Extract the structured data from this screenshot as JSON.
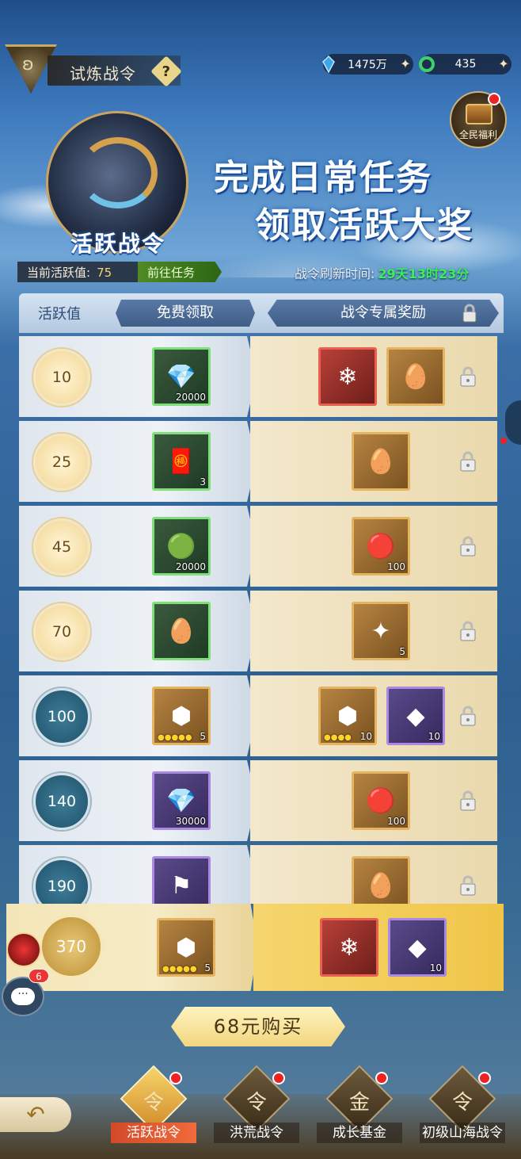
{
  "header": {
    "title": "试炼战令",
    "help_label": "?",
    "currency": [
      {
        "name": "jade-icon",
        "value": "1475万"
      },
      {
        "name": "ring-icon",
        "value": "435"
      }
    ],
    "welfare_label": "全民福利"
  },
  "banner": {
    "emblem_label": "活跃战令",
    "headline_1": "完成日常任务",
    "headline_2": "领取活跃大奖"
  },
  "activity": {
    "current_label": "当前活跃值:",
    "current_value": "75",
    "goto_label": "前往任务",
    "refresh_label": "战令刷新时间:",
    "refresh_value": "29天13时23分"
  },
  "table": {
    "col_activity": "活跃值",
    "col_free": "免费领取",
    "col_pass": "战令专属奖励",
    "rows": [
      {
        "value": "10",
        "style": "gold",
        "free": {
          "quality": "green",
          "icon": "💎",
          "count": "20000"
        },
        "pass": [
          {
            "quality": "red",
            "icon": "❄",
            "count": ""
          },
          {
            "quality": "gold",
            "icon": "🥚",
            "count": ""
          }
        ]
      },
      {
        "value": "25",
        "style": "gold",
        "free": {
          "quality": "green",
          "icon": "🧧",
          "count": "3"
        },
        "pass": [
          {
            "quality": "gold",
            "icon": "🥚",
            "count": ""
          }
        ]
      },
      {
        "value": "45",
        "style": "gold",
        "free": {
          "quality": "green",
          "icon": "🟢",
          "count": "20000"
        },
        "pass": [
          {
            "quality": "gold",
            "icon": "🔴",
            "count": "100"
          }
        ]
      },
      {
        "value": "70",
        "style": "gold",
        "free": {
          "quality": "green",
          "icon": "🥚",
          "count": ""
        },
        "pass": [
          {
            "quality": "gold",
            "icon": "✦",
            "count": "5"
          }
        ]
      },
      {
        "value": "100",
        "style": "blue",
        "free": {
          "quality": "gold",
          "icon": "⬢",
          "count": "5",
          "stars": "●●●●●"
        },
        "pass": [
          {
            "quality": "gold",
            "icon": "⬢",
            "count": "10",
            "stars": "●●●●"
          },
          {
            "quality": "purple",
            "icon": "◆",
            "count": "10"
          }
        ]
      },
      {
        "value": "140",
        "style": "blue",
        "free": {
          "quality": "purple",
          "icon": "💎",
          "count": "30000"
        },
        "pass": [
          {
            "quality": "gold",
            "icon": "🔴",
            "count": "100"
          }
        ]
      },
      {
        "value": "190",
        "style": "blue",
        "free": {
          "quality": "purple",
          "icon": "⚑",
          "count": ""
        },
        "pass": [
          {
            "quality": "gold",
            "icon": "🥚",
            "count": ""
          }
        ]
      }
    ],
    "highlight_row": {
      "value": "370",
      "free": {
        "quality": "gold",
        "icon": "⬢",
        "count": "5",
        "stars": "●●●●●"
      },
      "pass": [
        {
          "quality": "red",
          "icon": "❄",
          "count": ""
        },
        {
          "quality": "purple",
          "icon": "◆",
          "count": "10"
        }
      ]
    }
  },
  "chat_badge": "6",
  "buy_button": "68元购买",
  "bottom_nav": [
    {
      "label": "活跃战令",
      "glyph": "令",
      "active": true
    },
    {
      "label": "洪荒战令",
      "glyph": "令",
      "active": false
    },
    {
      "label": "成长基金",
      "glyph": "金",
      "active": false
    },
    {
      "label": "初级山海战令",
      "glyph": "令",
      "active": false
    }
  ]
}
